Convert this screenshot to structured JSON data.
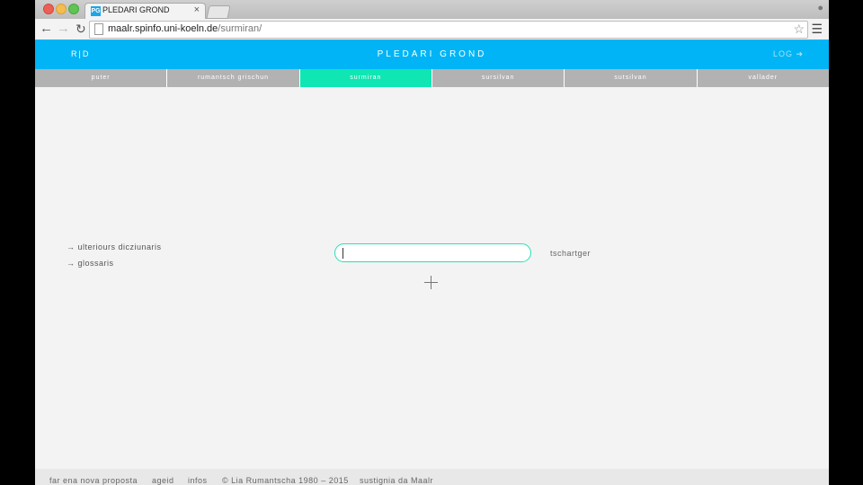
{
  "browser": {
    "tab_title": "PLEDARI GROND",
    "tab_favicon": "PG",
    "tab_close": "×",
    "url_host": "maalr.spinfo.uni-koeln.de",
    "url_path": "/surmiran/",
    "icons": {
      "back": "arrow-left-icon",
      "forward": "arrow-right-icon",
      "reload": "reload-icon",
      "bookmark": "star-icon",
      "menu": "hamburger-menu-icon",
      "user": "user-icon"
    }
  },
  "header": {
    "toggle": "R|D",
    "title": "PLEDARI GROND",
    "login": "LOG ➜"
  },
  "lang_tabs": [
    {
      "label": "puter"
    },
    {
      "label": "rumantsch grischun"
    },
    {
      "label": "surmiran"
    },
    {
      "label": "sursilvan"
    },
    {
      "label": "sutsilvan"
    },
    {
      "label": "vallader"
    }
  ],
  "active_tab_color": "#0fe6b3",
  "header_color": "#00b4f5",
  "side_links": [
    {
      "label": "→ ulteriours dicziunaris"
    },
    {
      "label": "→ glossaris"
    }
  ],
  "search": {
    "value": "",
    "language": "tschartger"
  },
  "footer": {
    "proposal": "far ena nova proposta",
    "help": "ageid",
    "infos": "infos",
    "copyright": "© Lia Rumantscha 1980 – 2015",
    "support": "sustignia da Maalr"
  }
}
